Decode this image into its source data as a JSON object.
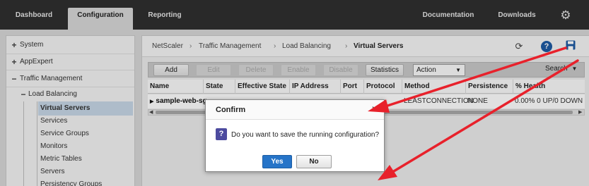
{
  "topnav": {
    "tabs": [
      "Dashboard",
      "Configuration",
      "Reporting"
    ],
    "active_tab": "Configuration",
    "right_links": [
      "Documentation",
      "Downloads"
    ],
    "settings_icon": "gear-icon"
  },
  "sidebar": {
    "items": [
      {
        "label": "System",
        "expander": "+"
      },
      {
        "label": "AppExpert",
        "expander": "+"
      },
      {
        "label": "Traffic Management",
        "expander": "−"
      },
      {
        "label": "Load Balancing",
        "expander": "−"
      },
      {
        "label": "Virtual Servers",
        "selected": true
      },
      {
        "label": "Services"
      },
      {
        "label": "Service Groups"
      },
      {
        "label": "Monitors"
      },
      {
        "label": "Metric Tables"
      },
      {
        "label": "Servers"
      },
      {
        "label": "Persistency Groups"
      }
    ]
  },
  "breadcrumb": {
    "items": [
      "NetScaler",
      "Traffic Management",
      "Load Balancing",
      "Virtual Servers"
    ],
    "separator": "›"
  },
  "toolbar": {
    "add": "Add",
    "edit": "Edit",
    "delete": "Delete",
    "enable": "Enable",
    "disable": "Disable",
    "statistics": "Statistics",
    "action": "Action",
    "search": "Search"
  },
  "table": {
    "columns": [
      "Name",
      "State",
      "Effective State",
      "IP Address",
      "Port",
      "Protocol",
      "Method",
      "Persistence",
      "% Health"
    ],
    "row": {
      "name": "sample-web-sg",
      "method": "LEASTCONNECTION",
      "persistence": "NONE",
      "health": "0.00% 0 UP/0 DOWN"
    }
  },
  "dialog": {
    "title": "Confirm",
    "message": "Do you want to save the running configuration?",
    "yes": "Yes",
    "no": "No",
    "icon": "question-icon"
  },
  "colors": {
    "topbar": "#2f2f2f",
    "selected": "#c6d6e6",
    "primary_button": "#2674c8",
    "annotation_arrow": "#e8212b",
    "save_icon": "#1e5aa3"
  }
}
